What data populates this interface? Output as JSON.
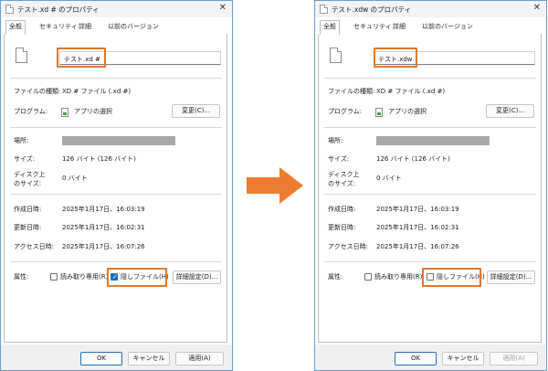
{
  "arrow_color": "#ec7d2f",
  "highlight_color": "#e07828",
  "dialogs": [
    {
      "title": "テスト.xd # のプロパティ",
      "tabs": [
        "全般",
        "セキュリティ",
        "詳細",
        "以前のバージョン"
      ],
      "filename": "テスト.xd #",
      "filetype_label": "ファイルの種類:",
      "filetype_value": "XD # ファイル (.xd #)",
      "program_label": "プログラム:",
      "program_value": "アプリの選択",
      "change_button": "変更(C)...",
      "location_label": "場所:",
      "size_label": "サイズ:",
      "size_value": "126 バイト (126 バイト)",
      "disk_size_label_1": "ディスク上",
      "disk_size_label_2": "のサイズ:",
      "disk_size_value": "0 バイト",
      "created_label": "作成日時:",
      "created_value": "2025年1月17日、16:03:19",
      "modified_label": "更新日時:",
      "modified_value": "2025年1月17日、16:02:31",
      "accessed_label": "アクセス日時:",
      "accessed_value": "2025年1月17日、16:07:26",
      "attributes_label": "属性:",
      "readonly_label": "読み取り専用(R)",
      "readonly_checked": false,
      "hidden_label": "隠しファイル(H)",
      "hidden_checked": true,
      "advanced_button": "詳細設定(D)...",
      "ok_button": "OK",
      "cancel_button": "キャンセル",
      "apply_button": "適用(A)",
      "apply_enabled": true
    },
    {
      "title": "テスト.xdw のプロパティ",
      "tabs": [
        "全般",
        "セキュリティ",
        "詳細",
        "以前のバージョン"
      ],
      "filename": "テスト.xdw",
      "filetype_label": "ファイルの種類:",
      "filetype_value": "XD # ファイル (.xd #)",
      "program_label": "プログラム:",
      "program_value": "アプリの選択",
      "change_button": "変更(C)...",
      "location_label": "場所:",
      "size_label": "サイズ:",
      "size_value": "126 バイト (126 バイト)",
      "disk_size_label_1": "ディスク上",
      "disk_size_label_2": "のサイズ:",
      "disk_size_value": "0 バイト",
      "created_label": "作成日時:",
      "created_value": "2025年1月17日、16:03:19",
      "modified_label": "更新日時:",
      "modified_value": "2025年1月17日、16:02:31",
      "accessed_label": "アクセス日時:",
      "accessed_value": "2025年1月17日、16:07:26",
      "attributes_label": "属性:",
      "readonly_label": "読み取り専用(R)",
      "readonly_checked": false,
      "hidden_label": "隠しファイル(H)",
      "hidden_checked": false,
      "advanced_button": "詳細設定(D)...",
      "ok_button": "OK",
      "cancel_button": "キャンセル",
      "apply_button": "適用(A)",
      "apply_enabled": false
    }
  ]
}
